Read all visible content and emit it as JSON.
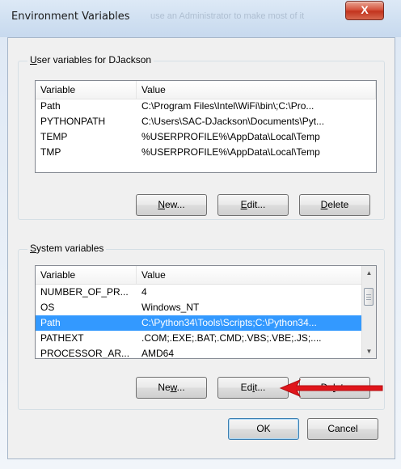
{
  "window": {
    "title": "Environment Variables",
    "background_caption": "use an Administrator to make most of it",
    "close_glyph": "X"
  },
  "user_vars": {
    "legend": {
      "u": "U",
      "rest": "ser variables for DJackson"
    },
    "columns": [
      "Variable",
      "Value"
    ],
    "rows": [
      {
        "name": "Path",
        "value": "C:\\Program Files\\Intel\\WiFi\\bin\\;C:\\Pro..."
      },
      {
        "name": "PYTHONPATH",
        "value": "C:\\Users\\SAC-DJackson\\Documents\\Pyt..."
      },
      {
        "name": "TEMP",
        "value": "%USERPROFILE%\\AppData\\Local\\Temp"
      },
      {
        "name": "TMP",
        "value": "%USERPROFILE%\\AppData\\Local\\Temp"
      }
    ],
    "buttons": {
      "new": {
        "u": "N",
        "rest": "ew..."
      },
      "edit": {
        "u": "E",
        "rest": "dit..."
      },
      "delete": {
        "u": "D",
        "rest": "elete"
      }
    }
  },
  "system_vars": {
    "legend": {
      "u": "S",
      "rest": "ystem variables"
    },
    "columns": [
      "Variable",
      "Value"
    ],
    "rows": [
      {
        "name": "NUMBER_OF_PR...",
        "value": "4"
      },
      {
        "name": "OS",
        "value": "Windows_NT"
      },
      {
        "name": "Path",
        "value": "C:\\Python34\\Tools\\Scripts;C:\\Python34...",
        "selected": true
      },
      {
        "name": "PATHEXT",
        "value": ".COM;.EXE;.BAT;.CMD;.VBS;.VBE;.JS;...."
      },
      {
        "name": "PROCESSOR_AR...",
        "value": "AMD64"
      }
    ],
    "buttons": {
      "new": {
        "pre": "Ne",
        "u": "w",
        "rest": "..."
      },
      "edit": {
        "pre": "Ed",
        "u": "i",
        "rest": "t..."
      },
      "delete": {
        "pre": "De",
        "u": "l",
        "rest": "ete"
      }
    }
  },
  "footer": {
    "ok": "OK",
    "cancel": "Cancel"
  },
  "colors": {
    "selection": "#3399ff",
    "arrow": "#e0151b"
  }
}
